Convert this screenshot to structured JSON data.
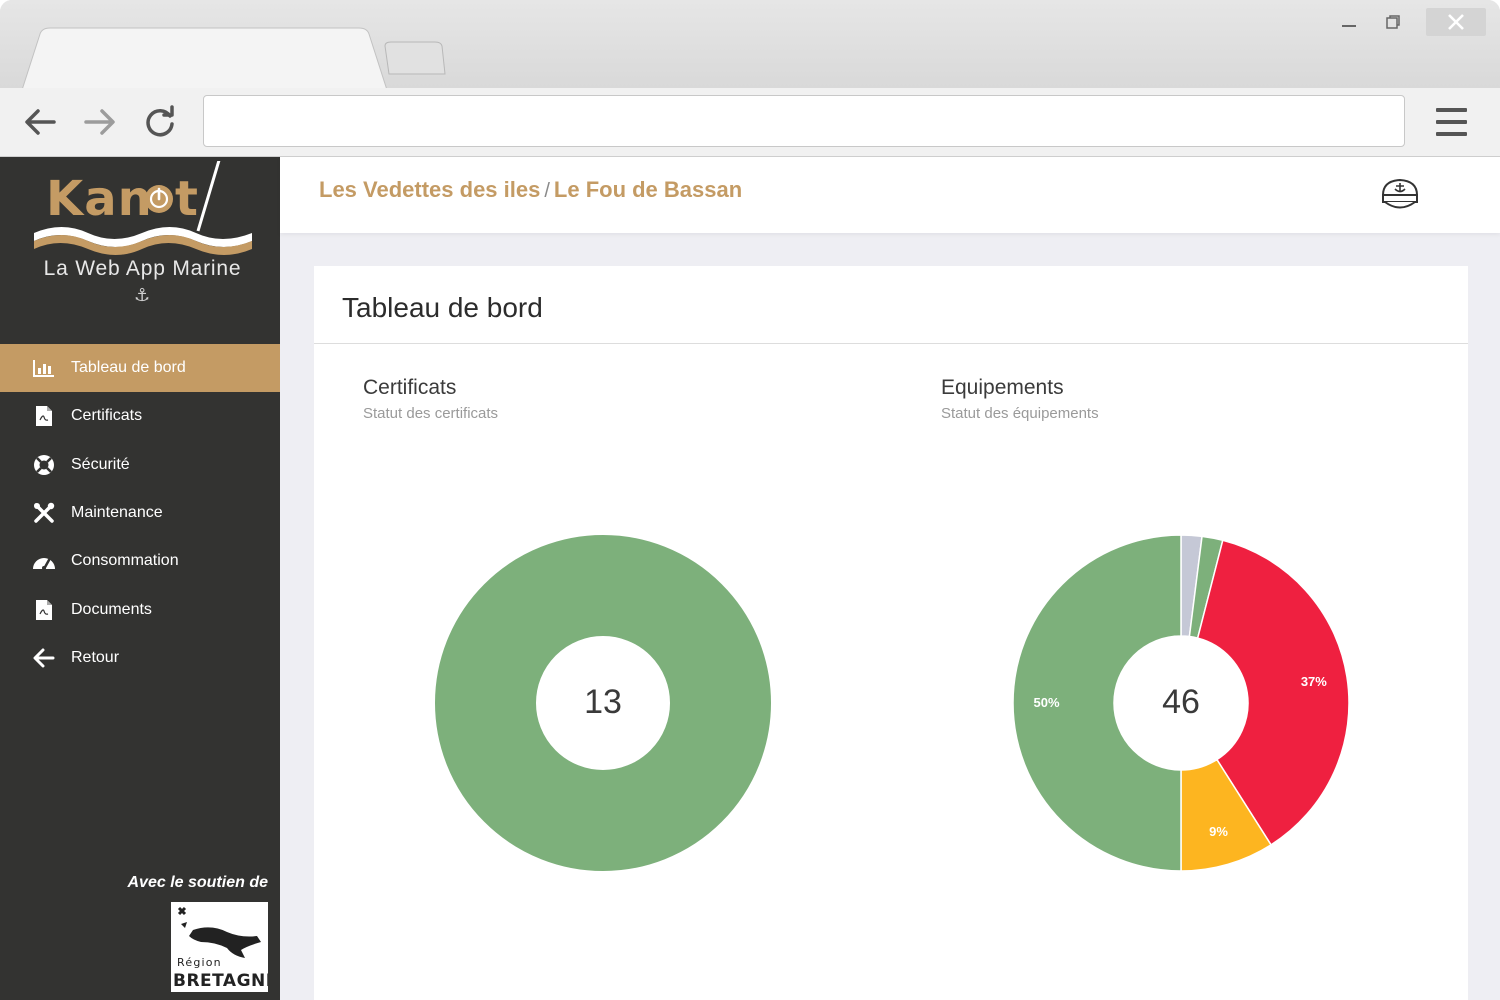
{
  "browser": {
    "address": "",
    "icons": {
      "back": "arrow-left-icon",
      "forward": "arrow-right-icon",
      "reload": "reload-icon",
      "menu": "hamburger-menu-icon",
      "close": "close-icon",
      "minimize": "minimize-icon",
      "restore": "restore-icon"
    }
  },
  "brand": {
    "name": "Kanot",
    "tagline": "La Web App Marine"
  },
  "sidebar": {
    "items": [
      {
        "label": "Tableau de bord",
        "icon": "bar-chart-icon",
        "active": true
      },
      {
        "label": "Certificats",
        "icon": "file-pdf-icon",
        "active": false
      },
      {
        "label": "Sécurité",
        "icon": "lifebuoy-icon",
        "active": false
      },
      {
        "label": "Maintenance",
        "icon": "tools-icon",
        "active": false
      },
      {
        "label": "Consommation",
        "icon": "gauge-icon",
        "active": false
      },
      {
        "label": "Documents",
        "icon": "file-pdf-icon",
        "active": false
      },
      {
        "label": "Retour",
        "icon": "arrow-left-icon",
        "active": false
      }
    ],
    "support_label": "Avec le soutien de",
    "region_logo_text": [
      "Région",
      "BRETAGNE"
    ]
  },
  "header": {
    "breadcrumb": [
      "Les Vedettes des iles",
      "Le Fou de Bassan"
    ],
    "separator": "/",
    "user_icon": "captain-hat-icon"
  },
  "colors": {
    "accent": "#c49b64",
    "sidebar": "#333331",
    "green": "#7db07b",
    "red": "#ef2040",
    "yellow": "#fdb520",
    "grey": "#c5c8d6"
  },
  "page": {
    "title": "Tableau de bord"
  },
  "chart_data": [
    {
      "type": "pie",
      "title": "Certificats",
      "subtitle": "Statut des certificats",
      "total_label": "13",
      "series": [
        {
          "value": 100,
          "color": "#7db07b"
        }
      ]
    },
    {
      "type": "pie",
      "title": "Equipements",
      "subtitle": "Statut des équipements",
      "total_label": "46",
      "series": [
        {
          "value": 2,
          "color": "#c5c8d6",
          "label": ""
        },
        {
          "value": 2,
          "color": "#7db07b",
          "label": ""
        },
        {
          "value": 37,
          "color": "#ef2040",
          "label": "37%"
        },
        {
          "value": 9,
          "color": "#fdb520",
          "label": "9%"
        },
        {
          "value": 50,
          "color": "#7db07b",
          "label": "50%"
        }
      ]
    }
  ]
}
